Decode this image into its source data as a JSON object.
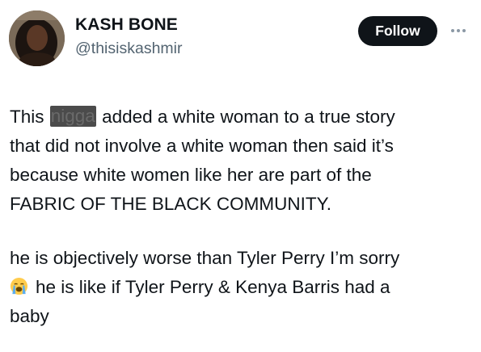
{
  "author": {
    "display_name": "KASH BONE",
    "handle": "@thisiskashmir"
  },
  "actions": {
    "follow_label": "Follow",
    "more_icon": "more-horizontal-icon"
  },
  "tweet": {
    "paragraph1": {
      "line1_before": "This ",
      "line1_redacted": "nigga",
      "line1_after": " added a white woman to a true story",
      "line2": "that did not involve a white woman then said it’s",
      "line3": "because white women like her are part of the",
      "line4": "FABRIC OF THE BLACK COMMUNITY."
    },
    "paragraph2": {
      "line1": "he is objectively worse than Tyler Perry I’m sorry",
      "line2_emoji": "loudly-crying-face-icon",
      "line2": "he is like if Tyler Perry & Kenya Barris had a",
      "line3": "baby"
    }
  },
  "colors": {
    "text": "#0f1419",
    "secondary_text": "#536471",
    "follow_button_bg": "#0f1419",
    "follow_button_text": "#ffffff"
  }
}
